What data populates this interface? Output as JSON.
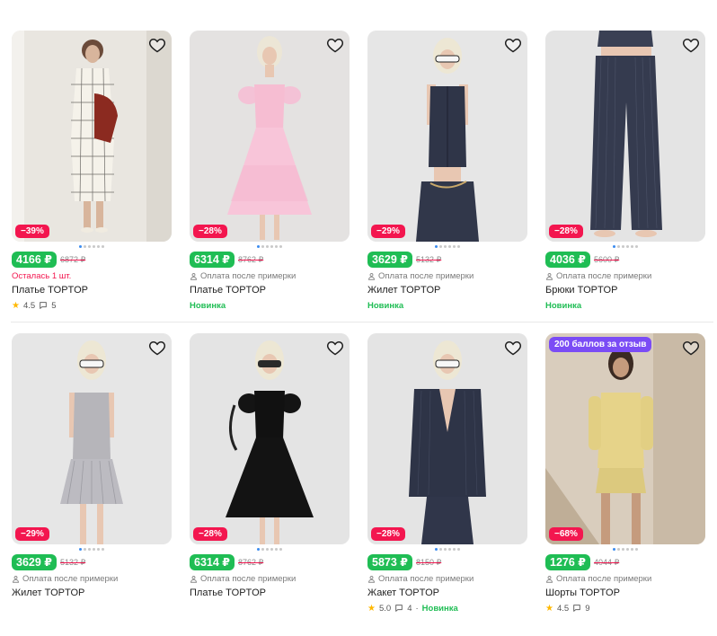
{
  "products": [
    {
      "price": "4166 ₽",
      "old_price": "6872 ₽",
      "discount": "−39%",
      "subtitle": "Осталась 1 шт.",
      "title": "Платье TOPTOP",
      "rating": "4.5",
      "reviews": "5",
      "tag": "",
      "promo": "",
      "bg": "#e9e6e0"
    },
    {
      "price": "6314 ₽",
      "old_price": "8762 ₽",
      "discount": "−28%",
      "subtitle": "Оплата после примерки",
      "title": "Платье TOPTOP",
      "rating": "",
      "reviews": "",
      "tag": "Новинка",
      "promo": "",
      "bg": "#e4e2e1"
    },
    {
      "price": "3629 ₽",
      "old_price": "5132 ₽",
      "discount": "−29%",
      "subtitle": "Оплата после примерки",
      "title": "Жилет TOPTOP",
      "rating": "",
      "reviews": "",
      "tag": "Новинка",
      "promo": "",
      "bg": "#e6e6e6"
    },
    {
      "price": "4036 ₽",
      "old_price": "5600 ₽",
      "discount": "−28%",
      "subtitle": "Оплата после примерки",
      "title": "Брюки TOPTOP",
      "rating": "",
      "reviews": "",
      "tag": "Новинка",
      "promo": "",
      "bg": "#e4e4e4"
    },
    {
      "price": "3629 ₽",
      "old_price": "5132 ₽",
      "discount": "−29%",
      "subtitle": "Оплата после примерки",
      "title": "Жилет TOPTOP",
      "rating": "",
      "reviews": "",
      "tag": "",
      "promo": "",
      "bg": "#e6e6e6"
    },
    {
      "price": "6314 ₽",
      "old_price": "8762 ₽",
      "discount": "−28%",
      "subtitle": "Оплата после примерки",
      "title": "Платье TOPTOP",
      "rating": "",
      "reviews": "",
      "tag": "",
      "promo": "",
      "bg": "#e4e4e4"
    },
    {
      "price": "5873 ₽",
      "old_price": "8150 ₽",
      "discount": "−28%",
      "subtitle": "Оплата после примерки",
      "title": "Жакет TOPTOP",
      "rating": "5.0",
      "reviews": "4",
      "tag": "Новинка",
      "promo": "",
      "bg": "#e4e4e4"
    },
    {
      "price": "1276 ₽",
      "old_price": "4044 ₽",
      "discount": "−68%",
      "subtitle": "Оплата после примерки",
      "title": "Шорты TOPTOP",
      "rating": "4.5",
      "reviews": "9",
      "tag": "",
      "promo": "200 баллов за отзыв",
      "bg": "#d9cdbd"
    }
  ],
  "colors": {
    "price_bg": "#1fbd54",
    "discount_bg": "#f3164f",
    "promo_bg": "#7b4cf5",
    "new_text": "#1fbd54",
    "dot_active": "#3c8cf0"
  },
  "icons": {
    "favorite": "heart-outline-icon",
    "person": "person-icon",
    "rating": "star-icon",
    "reviews": "comment-icon"
  }
}
